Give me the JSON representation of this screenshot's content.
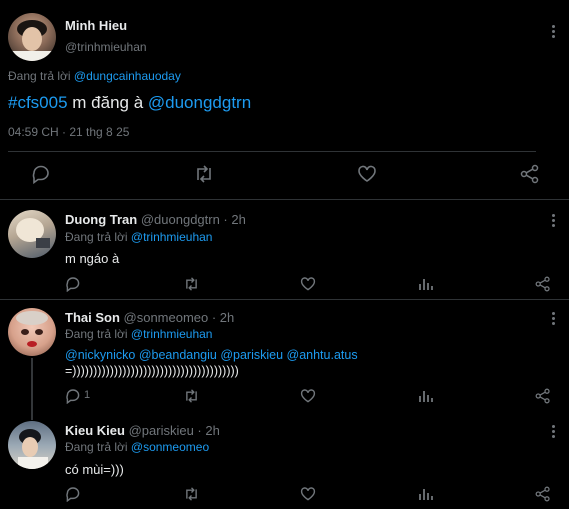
{
  "main_tweet": {
    "name": "Minh Hieu",
    "handle": "@trinhmieuhan",
    "reply_prefix": "Đang trả lời ",
    "reply_to": "@dungcainhauoday",
    "hashtag": "#cfs005",
    "text_middle": " m đăng à ",
    "mention": "@duongdgtrn",
    "timestamp": "04:59 CH · 21 thg 8 25"
  },
  "replies": [
    {
      "name": "Duong Tran",
      "handle_time": "@duongdgtrn · 2h",
      "reply_prefix": "Đang trả lời ",
      "reply_to": "@trinhmieuhan",
      "text": "m ngáo à",
      "reply_count": ""
    },
    {
      "name": "Thai Son",
      "handle_time": "@sonmeomeo · 2h",
      "reply_prefix": "Đang trả lời ",
      "reply_to": "@trinhmieuhan",
      "mentions": "@nickynicko @beandangiu @pariskieu @anhtu.atus",
      "text": "=))))))))))))))))))))))))))))))))))))))))",
      "reply_count": "1"
    },
    {
      "name": "Kieu Kieu",
      "handle_time": "@pariskieu · 2h",
      "reply_prefix": "Đang trả lời ",
      "reply_to": "@sonmeomeo",
      "text": "có mùi=)))",
      "reply_count": ""
    }
  ],
  "colors": {
    "accent": "#1d9bf0",
    "muted": "#71767b",
    "background": "#000000",
    "text": "#e7e9ea"
  }
}
